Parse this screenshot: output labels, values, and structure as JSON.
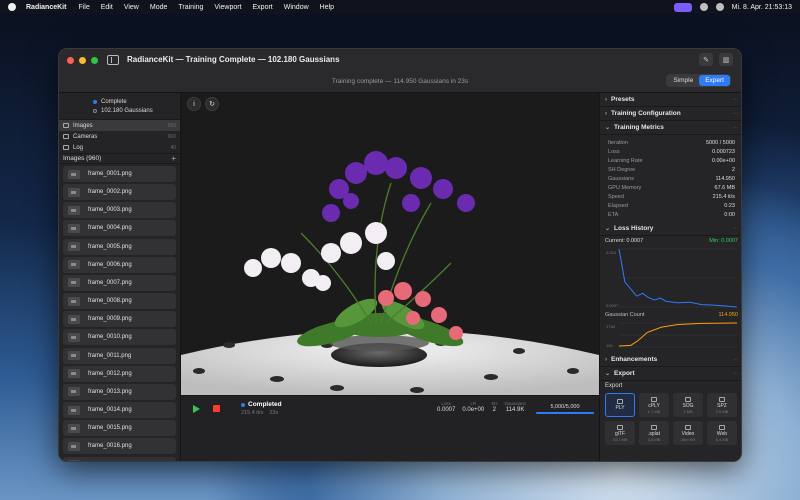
{
  "menubar": {
    "app_name": "RadianceKit",
    "items": [
      "File",
      "Edit",
      "View",
      "Mode",
      "Training",
      "Viewport",
      "Export",
      "Window",
      "Help"
    ],
    "clock": "Mi. 8. Apr.  21:53:13"
  },
  "window": {
    "title": "RadianceKit — Training Complete — 102.180 Gaussians",
    "status_line": "Training complete — 114.950 Gaussians in 23s",
    "mode": {
      "simple": "Simple",
      "expert": "Expert",
      "active": "expert"
    }
  },
  "sidebar": {
    "status": "Complete",
    "gaussians": "102.180 Gaussians",
    "nav": [
      {
        "label": "Images",
        "count": "960"
      },
      {
        "label": "Cameras",
        "count": "960"
      },
      {
        "label": "Log",
        "count": "40"
      }
    ],
    "list_title": "Images (960)",
    "files": [
      "frame_0001.png",
      "frame_0002.png",
      "frame_0003.png",
      "frame_0004.png",
      "frame_0005.png",
      "frame_0006.png",
      "frame_0007.png",
      "frame_0008.png",
      "frame_0009.png",
      "frame_0010.png",
      "frame_0011.png",
      "frame_0012.png",
      "frame_0013.png",
      "frame_0014.png",
      "frame_0015.png",
      "frame_0016.png",
      "frame_0017.png"
    ]
  },
  "viewport": {
    "info_icon": "info-icon",
    "reset_icon": "rotate-icon"
  },
  "controls": {
    "status": "Completed",
    "speed": "215.4 it/s",
    "elapsed": "23s",
    "stats": [
      {
        "label": "Loss",
        "value": "0.0007"
      },
      {
        "label": "LR",
        "value": "0.0e+00"
      },
      {
        "label": "SH",
        "value": "2"
      },
      {
        "label": "Gaussians",
        "value": "114.9K"
      }
    ],
    "progress_text": "5,000/5,000",
    "progress": 1.0
  },
  "inspector": {
    "presets": "Presets",
    "training_config": "Training Configuration",
    "training_metrics": "Training Metrics",
    "metrics": [
      {
        "label": "Iteration",
        "value": "5000 / 5000"
      },
      {
        "label": "Loss",
        "value": "0.000723"
      },
      {
        "label": "Learning Rate",
        "value": "0.00e+00"
      },
      {
        "label": "SH Degree",
        "value": "2"
      },
      {
        "label": "Gaussians",
        "value": "114.950"
      },
      {
        "label": "GPU Memory",
        "value": "67.6 MB"
      },
      {
        "label": "Speed",
        "value": "215.4 it/s"
      },
      {
        "label": "Elapsed",
        "value": "0:23"
      },
      {
        "label": "ETA",
        "value": "0:00"
      }
    ],
    "loss_history": "Loss History",
    "loss_current": "Current: 0.0007",
    "loss_min": "Min: 0.0007",
    "gaussian_count": "Gaussian Count",
    "gaussian_value": "114.950",
    "enhancements": "Enhancements",
    "export": "Export",
    "export_label": "Export",
    "formats": [
      {
        "name": "PLY",
        "size": ""
      },
      {
        "name": "cPLY",
        "size": "1.7 MB"
      },
      {
        "name": "SOG",
        "size": "1 MB"
      },
      {
        "name": "SPZ",
        "size": "2.5 MB"
      },
      {
        "name": "glTF",
        "size": "33,1 MB"
      },
      {
        "name": ".splat",
        "size": "3,5 MB"
      },
      {
        "name": "Video",
        "size": "26m KB"
      },
      {
        "name": "Web",
        "size": "6,4 MB"
      }
    ]
  },
  "chart_data": [
    {
      "type": "line",
      "title": "Loss History",
      "ylim": [
        0.0007,
        0.013
      ],
      "xlim": [
        0,
        5000
      ],
      "tick_labels_y": [
        "0.013",
        "0.0007"
      ],
      "series": [
        {
          "name": "Loss",
          "color": "#2f7bf5",
          "x": [
            0,
            250,
            500,
            750,
            1000,
            1250,
            1500,
            1750,
            2000,
            2500,
            3000,
            3500,
            4000,
            4500,
            5000
          ],
          "y": [
            0.013,
            0.006,
            0.0045,
            0.003,
            0.0036,
            0.0027,
            0.0022,
            0.0026,
            0.0019,
            0.0016,
            0.0017,
            0.0012,
            0.0011,
            0.0009,
            0.0007
          ]
        }
      ]
    },
    {
      "type": "line",
      "title": "Gaussian Count",
      "ylim": [
        0,
        114950
      ],
      "xlim": [
        0,
        5000
      ],
      "tick_labels_y": [
        "1748",
        "100"
      ],
      "series": [
        {
          "name": "Gaussian Count",
          "color": "#ff9f0a",
          "x": [
            0,
            500,
            800,
            1200,
            1800,
            2500,
            3500,
            5000
          ],
          "y": [
            5000,
            8000,
            30000,
            70000,
            95000,
            108000,
            113000,
            114950
          ]
        }
      ]
    }
  ]
}
